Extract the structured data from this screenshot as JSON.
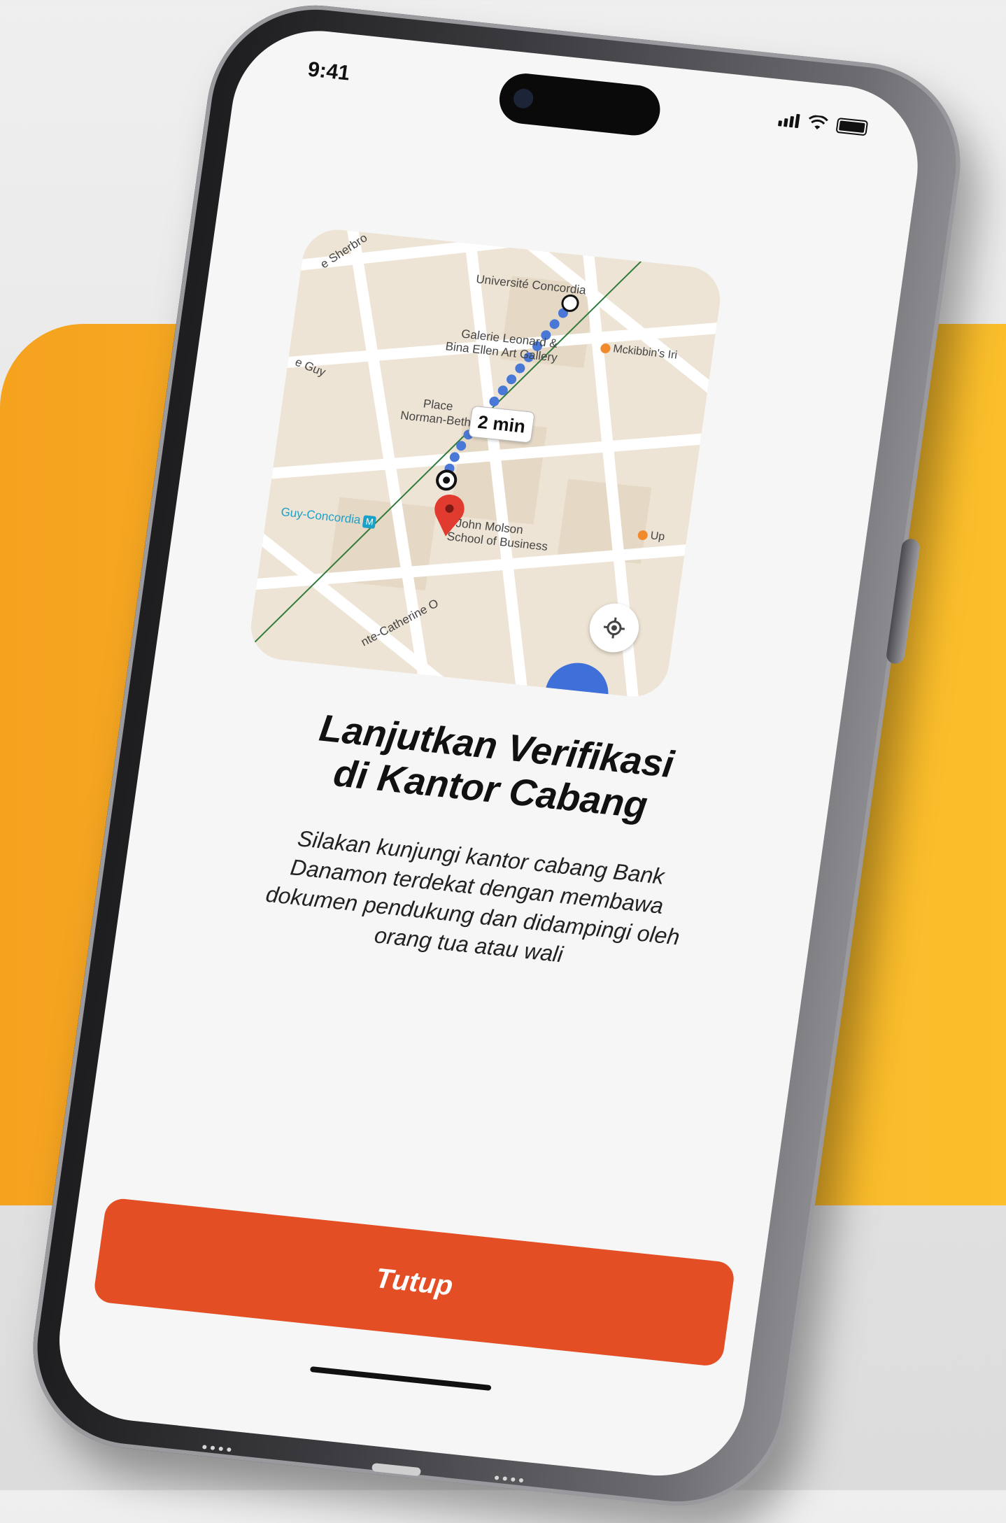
{
  "status_bar": {
    "time": "9:41"
  },
  "map": {
    "labels": {
      "university": "Université Concordia",
      "gallery_line1": "Galerie Leonard &",
      "gallery_line2": "Bina Ellen Art Gallery",
      "mckibbins": "Mckibbin's Iri",
      "place_line1": "Place",
      "place_line2": "Norman-Bethune",
      "guy": "e Guy",
      "sherbrooke": "e Sherbro",
      "metro": "Guy-Concordia",
      "metro_icon": "M",
      "john_molson_line1": "John Molson",
      "john_molson_line2": "School of Business",
      "up": "Up",
      "catherine": "nte-Catherine O"
    },
    "route_time": "2 min",
    "route_color": "#4a78d6"
  },
  "content": {
    "title_line1": "Lanjutkan Verifikasi",
    "title_line2": "di Kantor Cabang",
    "desc_line1": "Silakan kunjungi kantor cabang Bank",
    "desc_line2": "Danamon terdekat dengan membawa",
    "desc_line3": "dokumen pendukung dan didampingi oleh",
    "desc_line4": "orang tua atau wali"
  },
  "actions": {
    "close_label": "Tutup"
  },
  "colors": {
    "accent": "#e44e24",
    "background_band": "#f5a21f"
  }
}
